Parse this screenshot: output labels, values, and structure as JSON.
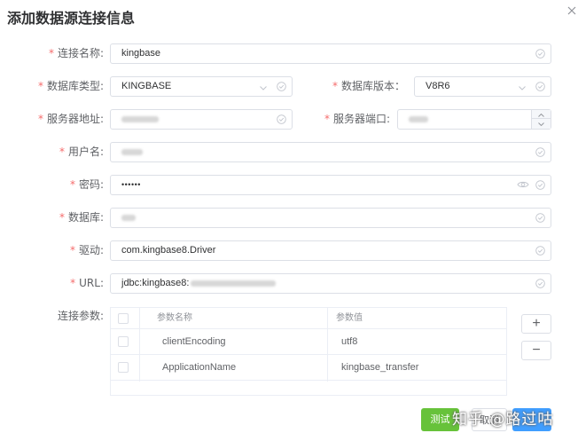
{
  "dialog": {
    "title": "添加数据源连接信息"
  },
  "form": {
    "conn_name": {
      "label": "连接名称:",
      "value": "kingbase"
    },
    "db_type": {
      "label": "数据库类型:",
      "value": "KINGBASE"
    },
    "db_version": {
      "label": "数据库版本：",
      "value": "V8R6"
    },
    "server_addr": {
      "label": "服务器地址:"
    },
    "server_port": {
      "label": "服务器端口:"
    },
    "username": {
      "label": "用户名:"
    },
    "password": {
      "label": "密码:",
      "value": "••••••"
    },
    "database": {
      "label": "数据库:"
    },
    "driver": {
      "label": "驱动:",
      "value": "com.kingbase8.Driver"
    },
    "url": {
      "label": "URL:",
      "value": "jdbc:kingbase8:"
    },
    "params": {
      "label": "连接参数:",
      "columns": [
        "参数名称",
        "参数值"
      ],
      "rows": [
        {
          "name": "clientEncoding",
          "value": "utf8"
        },
        {
          "name": "ApplicationName",
          "value": "kingbase_transfer"
        }
      ],
      "add_label": "+",
      "remove_label": "−"
    }
  },
  "footer": {
    "test_label": "测试",
    "cancel_label": "取消",
    "test_color": "#67c23a",
    "cancel_color": "#409eff"
  },
  "watermark": "知乎 @路过咕",
  "icons": {
    "close": "close-icon",
    "valid": "circle-check-icon",
    "dropdown": "chevron-down-icon",
    "eye": "eye-icon",
    "stepper_up": "chevron-up-icon",
    "stepper_down": "chevron-down-icon"
  }
}
